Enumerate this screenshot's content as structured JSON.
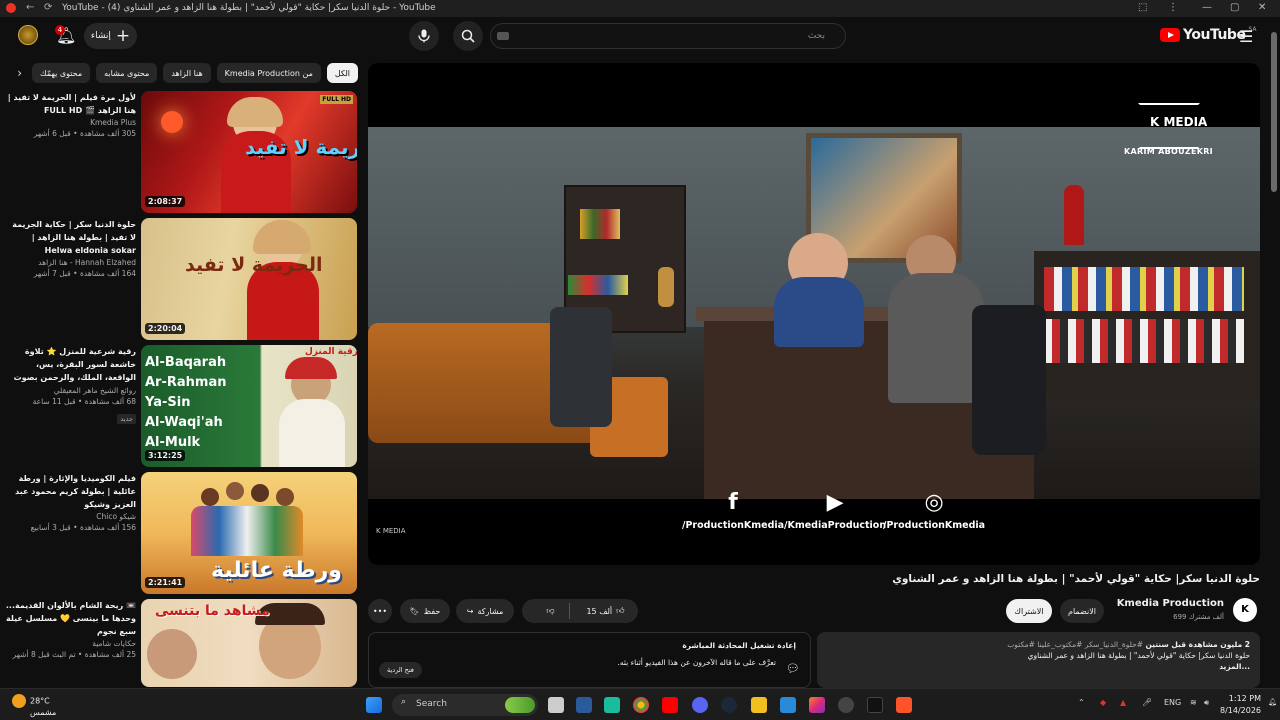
{
  "browser": {
    "window_title": "YouTube - حلوة الدنيا سكر| حكاية \"قولي لأحمد\" | بطولة هنا الزاهد و عمر الشناوي (4) - YouTube"
  },
  "header": {
    "search_placeholder": "بحث",
    "create_label": "إنشاء",
    "notifications_count": "4",
    "logo_text": "YouTube",
    "logo_region": "SA"
  },
  "chips": [
    "الكل",
    "من Kmedia Production",
    "هنا الزاهد",
    "محتوى مشابه",
    "محتوى يهمّك"
  ],
  "recommendations": [
    {
      "title": "لأول مرة فيلم | الجريمة لا تفيد | هنا الزاهد 🎬 FULL HD",
      "channel": "Kmedia Plus",
      "stats": "305 ألف مشاهدة • قبل 6 أشهر",
      "duration": "2:08:37",
      "thumb_text": "الجريمة لا تفيد",
      "badge": ""
    },
    {
      "title": "حلوة الدنيا سكر | حكاية الجريمة لا تفيد | بطولة هنا الزاهد | Helwa eldonia sokar",
      "channel": "Hannah Elzahed - هنا الزاهد",
      "stats": "164 ألف مشاهدة • قبل 7 أشهر",
      "duration": "2:20:04",
      "thumb_text": "الجريمة لا تفيد",
      "badge": ""
    },
    {
      "title": "رقية شرعية للمنزل ⭐ تلاوة خاشعة لسور البقرة، يس، الواقعة، الملك، والرحمن بصوت الشيخ ماهر المعيقلي 🌹",
      "channel": "روائع الشيخ ماهر المعيقلي",
      "stats": "68 ألف مشاهدة • قبل 11 ساعة",
      "duration": "3:12:25",
      "thumb_text": "رقية المنزل",
      "badge": "جديد"
    },
    {
      "title": "فيلم الكوميديا والإثارة | ورطة عائلية | بطولة كريم محمود عبد العزيز وشيكو",
      "channel": "شيكو Chico",
      "stats": "156 ألف مشاهدة • قبل 3 أسابيع",
      "duration": "2:21:41",
      "thumb_text": "ورطة عائلية",
      "badge": ""
    },
    {
      "title": "📼 ريحة الشام بالألوان القديمة... وحدها ما بينسى 💛 مسلسل عيلة سبع نجوم",
      "channel": "حكايات شامية",
      "stats": "25 ألف مشاهدة • تم البث قبل 8 أشهر",
      "duration": "",
      "thumb_text": "مشاهد ما بتنسى",
      "badge": ""
    }
  ],
  "player": {
    "brand_name": "KARIM ABOUZEKRI",
    "brand_logo": "K MEDIA",
    "watermark": "K MEDIA",
    "socials": [
      {
        "icon": "facebook-icon",
        "handle": "/ProductionKmedia"
      },
      {
        "icon": "youtube-icon",
        "handle": "/KmediaProduction"
      },
      {
        "icon": "instagram-icon",
        "handle": "/ProductionKmedia"
      }
    ]
  },
  "video": {
    "title": "حلوة الدنيا سكر| حكاية \"قولي لأحمد\" | بطولة هنا الزاهد و عمر الشناوي",
    "channel_name": "Kmedia Production",
    "subscribers": "699 ألف مشترك",
    "subscribe_label": "الاشتراك",
    "join_label": "الانضمام",
    "likes": "15 ألف",
    "share_label": "مشاركة",
    "save_label": "حفظ",
    "more_label": "•••"
  },
  "description": {
    "views_line": "2 مليون مشاهدة  قبل سنتين",
    "tags": "#حلوة_الدنيا_سكر #مكتوب_علينا #مكتوب",
    "text": "حلوة الدنيا سكر| حكاية \"قولي لأحمد\" | بطولة هنا الزاهد و عمر الشناوي",
    "more": "...المزيد"
  },
  "live_chat": {
    "title": "إعادة تشغيل المحادثة المباشرة",
    "subtitle": "تعرَّف على ما قاله الآخرون عن هذا الفيديو أثناء بثه.",
    "open_label": "فتح الردية"
  },
  "taskbar": {
    "weather_temp": "28°C",
    "weather_desc": "مشمس",
    "search_label": "Search",
    "lang": "ENG",
    "time": "1:12 PM",
    "date": "8/14/2026"
  }
}
